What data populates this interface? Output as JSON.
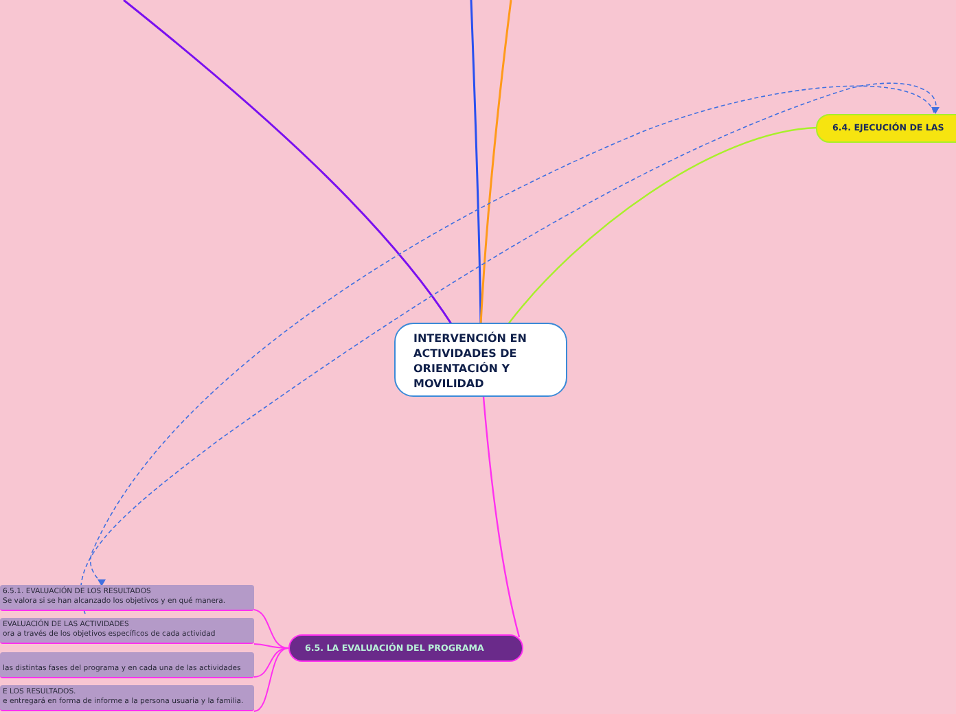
{
  "central_topic": {
    "title": "INTERVENCIÓN EN ACTIVIDADES DE ORIENTACIÓN Y MOVILIDAD"
  },
  "branches": [
    {
      "kind": "main",
      "label": "6.4. EJECUCIÓN DE LAS"
    },
    {
      "kind": "main",
      "label": "6.5. LA EVALUACIÓN DEL PROGRAMA",
      "children": [
        {
          "title": "6.5.1. EVALUACIÓN DE LOS RESULTADOS",
          "text": "Se valora si se han alcanzado los objetivos y en qué manera."
        },
        {
          "title": "EVALUACIÓN DE LAS ACTIVIDADES",
          "text": "ora a través de los objetivos específicos de cada actividad"
        },
        {
          "text": "las distintas fases del programa y en cada una de las actividades"
        },
        {
          "title": "E LOS RESULTADOS.",
          "text": "e entregará en forma de informe a la persona usuaria y la familia."
        }
      ]
    }
  ]
}
